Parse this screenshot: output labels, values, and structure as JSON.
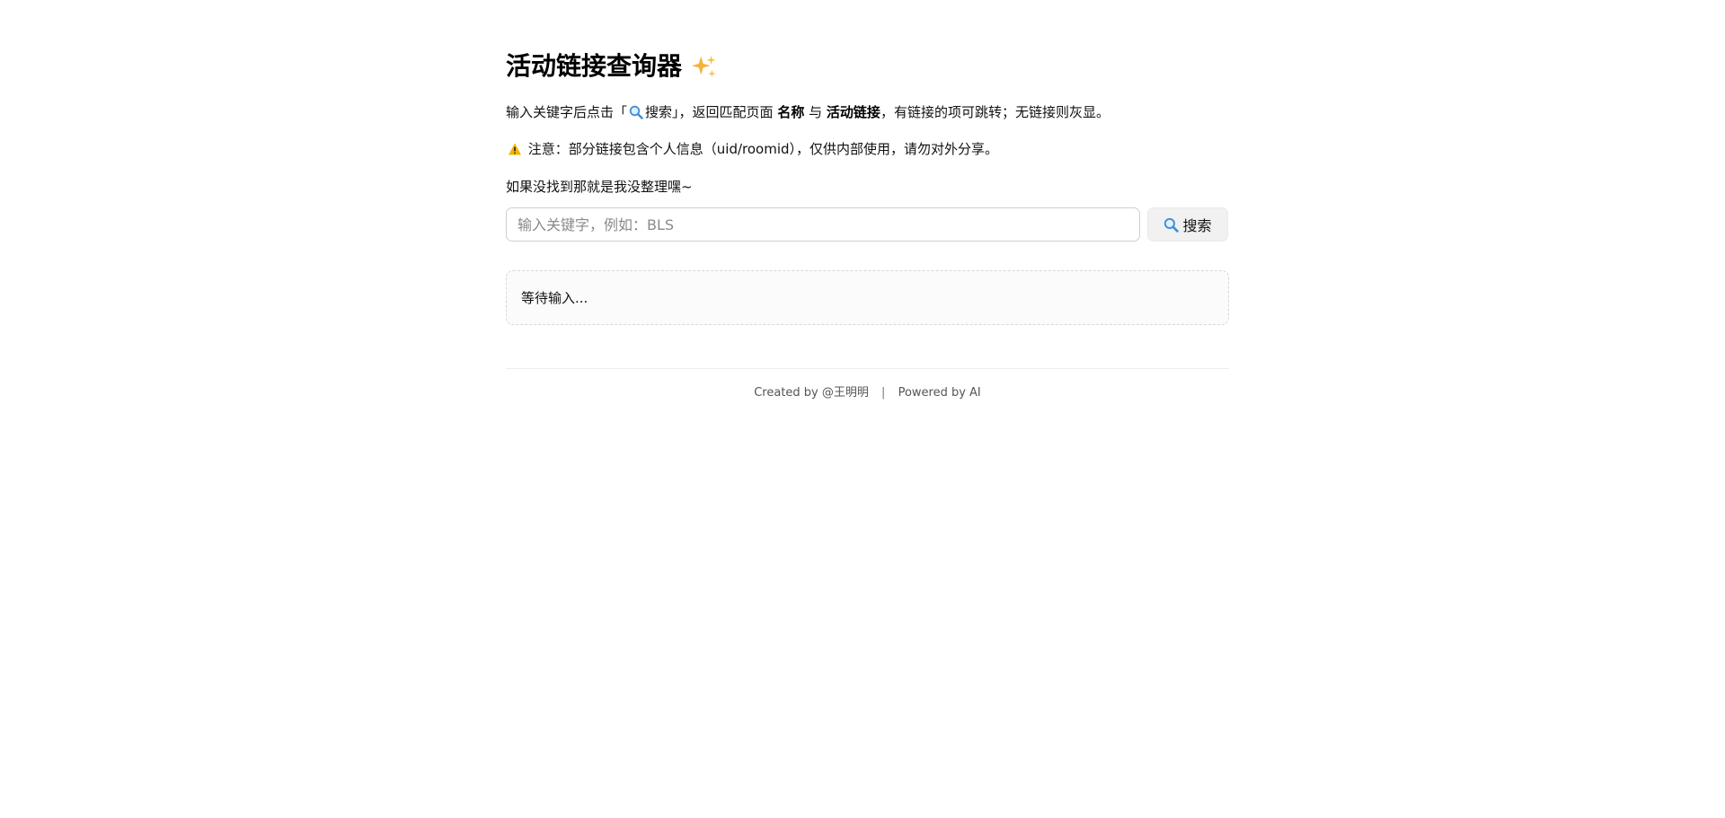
{
  "header": {
    "title": "活动链接查询器"
  },
  "intro": {
    "text_before": "输入关键字后点击「",
    "search_word": "搜索",
    "text_mid1": "」，返回匹配页面",
    "bold_name": "名称",
    "text_mid2": "与",
    "bold_link": "活动链接",
    "text_after": "，有链接的项可跳转；无链接则灰显。"
  },
  "warning": {
    "text": "注意：部分链接包含个人信息（uid/roomid），仅供内部使用，请勿对外分享。"
  },
  "note": {
    "text": "如果没找到那就是我没整理嘿~"
  },
  "search": {
    "placeholder": "输入关键字，例如：BLS",
    "value": "",
    "button_label": "搜索"
  },
  "result": {
    "status": "等待输入..."
  },
  "footer": {
    "created_by": "Created by @王明明",
    "separator": "|",
    "powered_by": "Powered by AI"
  },
  "icons": {
    "sparkles": "sparkles-icon",
    "magnifier": "magnifier-icon",
    "warning": "warning-icon"
  },
  "colors": {
    "text": "#111111",
    "muted": "#555555",
    "border": "#cfcfcf",
    "button_bg": "#f1f1f1",
    "result_bg": "#fbfbfb",
    "sparkle": "#f5b33d",
    "magnifier": "#3f8ed9",
    "warning": "#f3b400"
  }
}
